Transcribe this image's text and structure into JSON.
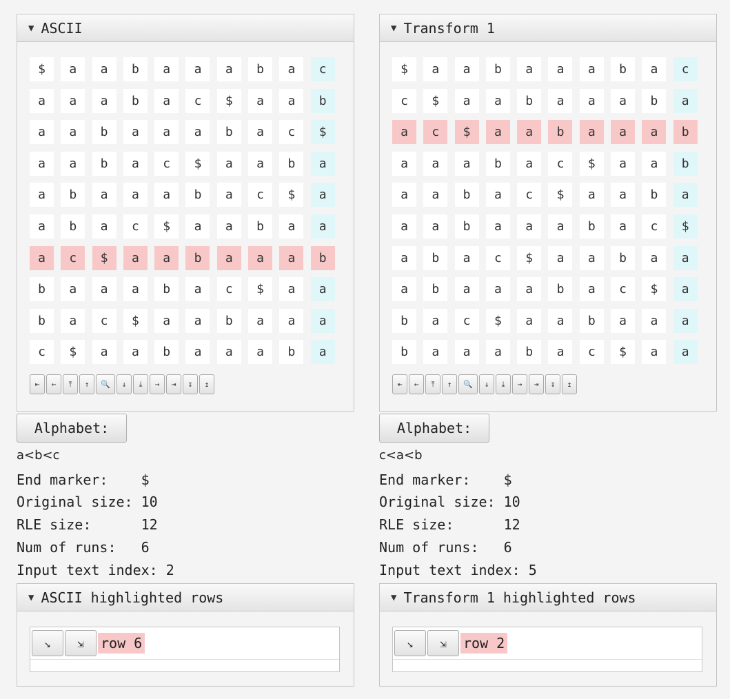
{
  "panels": [
    {
      "title": "ASCII",
      "grid": [
        [
          "$",
          "a",
          "a",
          "b",
          "a",
          "a",
          "a",
          "b",
          "a",
          "c"
        ],
        [
          "a",
          "a",
          "a",
          "b",
          "a",
          "c",
          "$",
          "a",
          "a",
          "b"
        ],
        [
          "a",
          "a",
          "b",
          "a",
          "a",
          "a",
          "b",
          "a",
          "c",
          "$"
        ],
        [
          "a",
          "a",
          "b",
          "a",
          "c",
          "$",
          "a",
          "a",
          "b",
          "a"
        ],
        [
          "a",
          "b",
          "a",
          "a",
          "a",
          "b",
          "a",
          "c",
          "$",
          "a"
        ],
        [
          "a",
          "b",
          "a",
          "c",
          "$",
          "a",
          "a",
          "b",
          "a",
          "a"
        ],
        [
          "a",
          "c",
          "$",
          "a",
          "a",
          "b",
          "a",
          "a",
          "a",
          "b"
        ],
        [
          "b",
          "a",
          "a",
          "a",
          "b",
          "a",
          "c",
          "$",
          "a",
          "a"
        ],
        [
          "b",
          "a",
          "c",
          "$",
          "a",
          "a",
          "b",
          "a",
          "a",
          "a"
        ],
        [
          "c",
          "$",
          "a",
          "a",
          "b",
          "a",
          "a",
          "a",
          "b",
          "a"
        ]
      ],
      "highlighted_row": 6,
      "alphabet_button": "Alphabet:",
      "alphabet_order": "a<b<c",
      "end_marker": "End marker:    $",
      "original_size": "Original size: 10",
      "rle_size": "RLE size:      12",
      "num_runs": "Num of runs:   6",
      "input_index": "Input text index: 2",
      "hl_title": "ASCII highlighted rows",
      "hl_row_label": "row 6"
    },
    {
      "title": "Transform 1",
      "grid": [
        [
          "$",
          "a",
          "a",
          "b",
          "a",
          "a",
          "a",
          "b",
          "a",
          "c"
        ],
        [
          "c",
          "$",
          "a",
          "a",
          "b",
          "a",
          "a",
          "a",
          "b",
          "a"
        ],
        [
          "a",
          "c",
          "$",
          "a",
          "a",
          "b",
          "a",
          "a",
          "a",
          "b"
        ],
        [
          "a",
          "a",
          "a",
          "b",
          "a",
          "c",
          "$",
          "a",
          "a",
          "b"
        ],
        [
          "a",
          "a",
          "b",
          "a",
          "c",
          "$",
          "a",
          "a",
          "b",
          "a"
        ],
        [
          "a",
          "a",
          "b",
          "a",
          "a",
          "a",
          "b",
          "a",
          "c",
          "$"
        ],
        [
          "a",
          "b",
          "a",
          "c",
          "$",
          "a",
          "a",
          "b",
          "a",
          "a"
        ],
        [
          "a",
          "b",
          "a",
          "a",
          "a",
          "b",
          "a",
          "c",
          "$",
          "a"
        ],
        [
          "b",
          "a",
          "c",
          "$",
          "a",
          "a",
          "b",
          "a",
          "a",
          "a"
        ],
        [
          "b",
          "a",
          "a",
          "a",
          "b",
          "a",
          "c",
          "$",
          "a",
          "a"
        ]
      ],
      "highlighted_row": 2,
      "alphabet_button": "Alphabet:",
      "alphabet_order": "c<a<b",
      "end_marker": "End marker:    $",
      "original_size": "Original size: 10",
      "rle_size": "RLE size:      12",
      "num_runs": "Num of runs:   6",
      "input_index": "Input text index: 5",
      "hl_title": "Transform 1 highlighted rows",
      "hl_row_label": "row 2"
    }
  ],
  "toolbar_icons": [
    {
      "name": "first-column-icon",
      "glyph": "⇤"
    },
    {
      "name": "prev-column-icon",
      "glyph": "←"
    },
    {
      "name": "first-row-icon",
      "glyph": "⤒"
    },
    {
      "name": "prev-row-icon",
      "glyph": "↑"
    },
    {
      "name": "search-icon",
      "glyph": "🔍"
    },
    {
      "name": "next-row-icon",
      "glyph": "↓"
    },
    {
      "name": "last-row-icon",
      "glyph": "⤓"
    },
    {
      "name": "next-column-icon",
      "glyph": "→"
    },
    {
      "name": "last-column-icon",
      "glyph": "⇥"
    },
    {
      "name": "expand-rows-icon",
      "glyph": "↧"
    },
    {
      "name": "collapse-rows-icon",
      "glyph": "↥"
    }
  ],
  "highlight_buttons": [
    {
      "name": "go-to-row-icon",
      "glyph": "↘"
    },
    {
      "name": "go-to-last-row-icon",
      "glyph": "⇲"
    }
  ],
  "colors": {
    "highlight_row": "#f8c8c8",
    "last_column": "#e0f7fa",
    "cell": "#ffffff"
  }
}
